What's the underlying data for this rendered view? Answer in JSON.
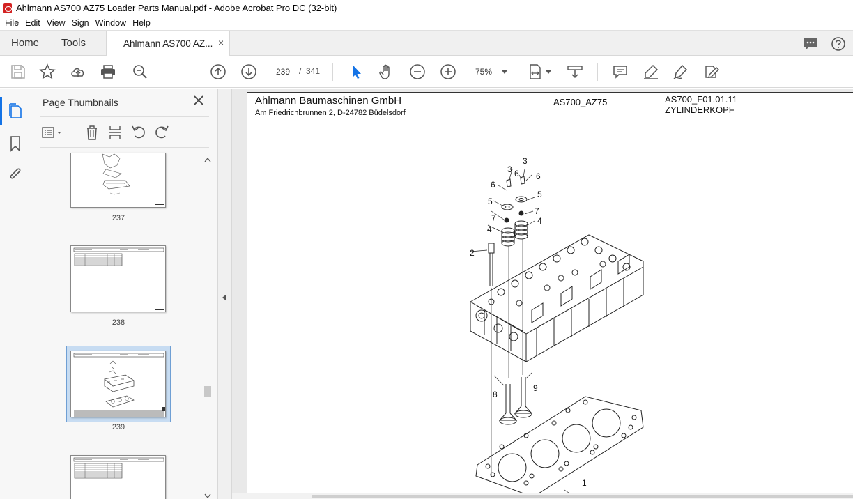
{
  "window": {
    "title": "Ahlmann AS700 AZ75 Loader Parts Manual.pdf - Adobe Acrobat Pro DC (32-bit)"
  },
  "menu": [
    "File",
    "Edit",
    "View",
    "Sign",
    "Window",
    "Help"
  ],
  "tabs": {
    "home": "Home",
    "tools": "Tools",
    "document": "Ahlmann AS700 AZ...",
    "close": "×"
  },
  "toolbar": {
    "page_current": "239",
    "page_separator": "/",
    "page_total": "341",
    "zoom": "75%"
  },
  "panel": {
    "title": "Page Thumbnails",
    "thumbnails": [
      {
        "label": "237"
      },
      {
        "label": "238"
      },
      {
        "label": "239"
      }
    ]
  },
  "document": {
    "company": "Ahlmann Baumaschinen GmbH",
    "address": "Am Friedrichbrunnen 2,  D-24782 Büdelsdorf",
    "model": "AS700_AZ75",
    "code": "AS700_F01.01.11",
    "name": "ZYLINDERKOPF",
    "callouts": [
      "3",
      "3",
      "6",
      "6",
      "6",
      "5",
      "5",
      "7",
      "7",
      "4",
      "4",
      "2",
      "8",
      "9",
      "1"
    ]
  },
  "colors": {
    "accent": "#1473e6",
    "pdf_red": "#d32222",
    "selected_thumb": "#c7dcf2"
  }
}
